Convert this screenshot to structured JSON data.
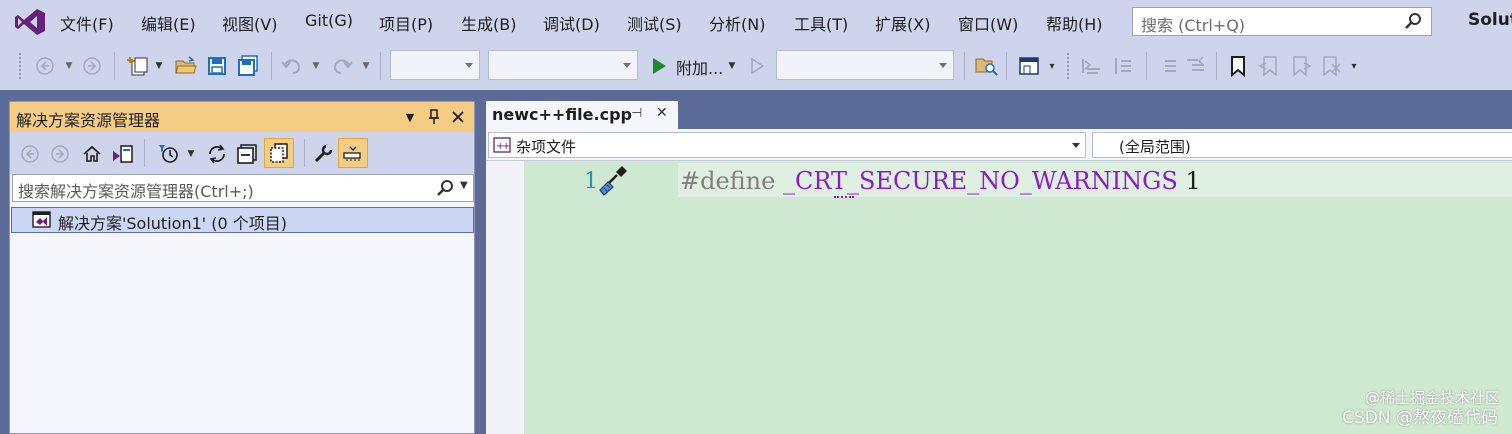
{
  "menu": {
    "items": [
      "文件(F)",
      "编辑(E)",
      "视图(V)",
      "Git(G)",
      "项目(P)",
      "生成(B)",
      "调试(D)",
      "测试(S)",
      "分析(N)",
      "工具(T)",
      "扩展(X)",
      "窗口(W)",
      "帮助(H)"
    ],
    "search_placeholder": "搜索 (Ctrl+Q)",
    "solution_label": "Solut"
  },
  "toolbar": {
    "attach_label": "附加...",
    "icons": [
      "back-icon",
      "forward-icon",
      "new-project-icon",
      "open-folder-icon",
      "save-icon",
      "save-all-icon",
      "undo-icon",
      "redo-icon",
      "start-icon",
      "find-in-files-icon",
      "bookmark-icon"
    ]
  },
  "solution_explorer": {
    "title": "解决方案资源管理器",
    "search_placeholder": "搜索解决方案资源管理器(Ctrl+;)",
    "tree": [
      {
        "label": "解决方案'Solution1' (0 个项目)",
        "selected": true
      }
    ]
  },
  "editor": {
    "tab_label": "newc++file.cpp",
    "nav_left": "杂项文件",
    "nav_right": "(全局范围)",
    "lines": [
      {
        "number": "1",
        "directive": "#define",
        "macro": "_CRT_SECURE_NO_WARNINGS",
        "value": "1"
      }
    ]
  },
  "watermark": {
    "line1": "@稀土掘金技术社区",
    "line2": "CSDN @熬夜磕代码"
  },
  "colors": {
    "accent": "#68217a",
    "menu_bg": "#cdd4ec",
    "panel_header": "#f5cc84",
    "code_bg": "#cfe8d1",
    "macro": "#8a1bcf"
  }
}
